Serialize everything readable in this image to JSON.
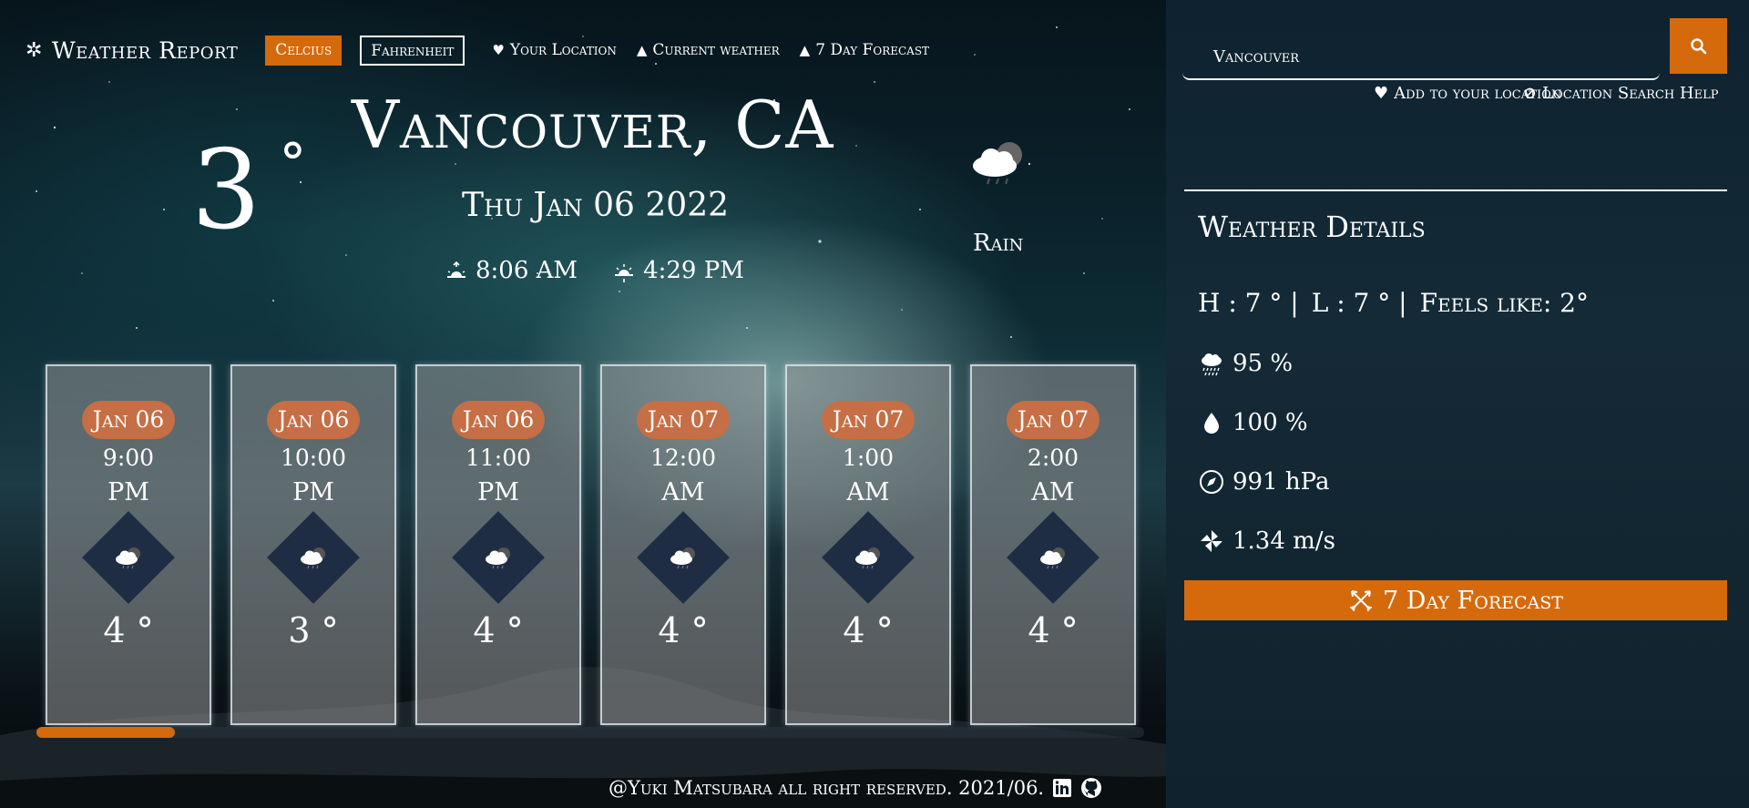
{
  "nav": {
    "brand": "Weather Report",
    "celsius_label": "Celcius",
    "fahrenheit_label": "Fahrenheit",
    "links": [
      "Your Location",
      "Current weather",
      "7 Day Forecast"
    ]
  },
  "current": {
    "temp": "3",
    "deg": "°",
    "city": "Vancouver, CA",
    "date": "Thu Jan 06 2022",
    "sunrise": "8:06 AM",
    "sunset": "4:29 PM",
    "condition": "Rain"
  },
  "hourly": [
    {
      "date": "Jan 06",
      "time": "9:00",
      "ampm": "PM",
      "temp": "4 °"
    },
    {
      "date": "Jan 06",
      "time": "10:00",
      "ampm": "PM",
      "temp": "3 °"
    },
    {
      "date": "Jan 06",
      "time": "11:00",
      "ampm": "PM",
      "temp": "4 °"
    },
    {
      "date": "Jan 07",
      "time": "12:00",
      "ampm": "AM",
      "temp": "4 °"
    },
    {
      "date": "Jan 07",
      "time": "1:00",
      "ampm": "AM",
      "temp": "4 °"
    },
    {
      "date": "Jan 07",
      "time": "2:00",
      "ampm": "AM",
      "temp": "4 °"
    }
  ],
  "footer": {
    "text": "@Yuki Matsubara all right reserved. 2021/06."
  },
  "sidebar": {
    "search_value": "Vancouver",
    "add_location": "Add to your location",
    "search_help": "Location Search Help",
    "details_title": "Weather Details",
    "high": "H : 7 ° |",
    "low": "L : 7 ° |",
    "feels_like": "Feels like: 2°",
    "precip": "95 %",
    "humidity": "100 %",
    "pressure": "991 hPa",
    "wind": "1.34 m/s",
    "forecast_button": "7 Day Forecast"
  },
  "colors": {
    "accent": "#d46a0c",
    "date_pill": "#c66e45",
    "icon_diamond": "#1f2d44"
  }
}
